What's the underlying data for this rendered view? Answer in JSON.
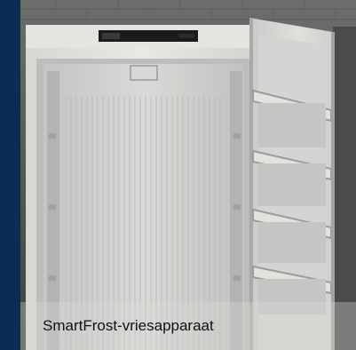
{
  "caption": "SmartFrost-vriesapparaat",
  "colors": {
    "frame_background": "#0b2c55",
    "caption_text": "#111111"
  }
}
